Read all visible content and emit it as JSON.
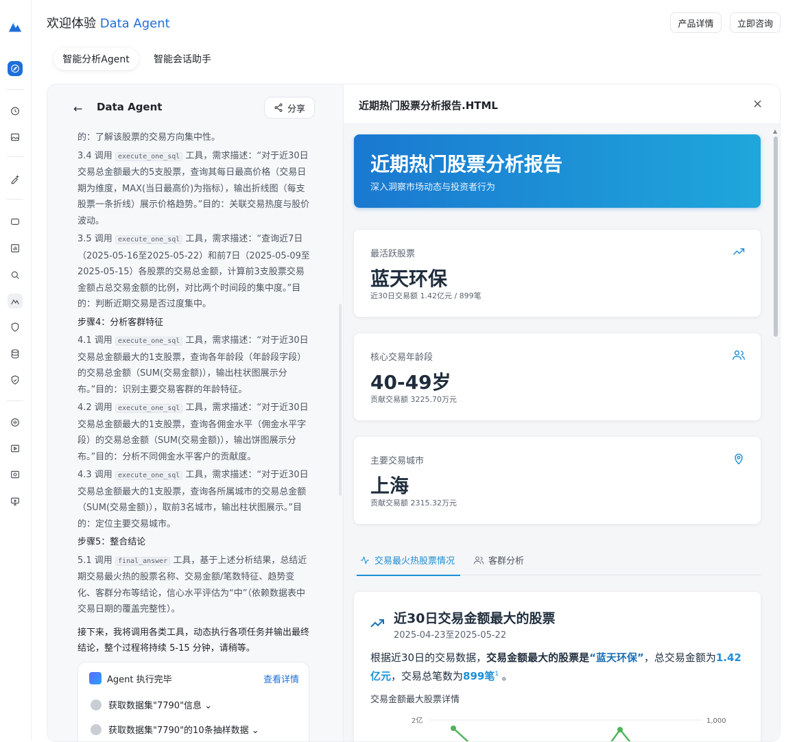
{
  "app": {
    "title_prefix": "欢迎体验",
    "title_highlight": "Data Agent",
    "btn_product": "产品详情",
    "btn_consult": "立即咨询"
  },
  "tabs": [
    "智能分析Agent",
    "智能会话助手"
  ],
  "left": {
    "agent_name": "Data Agent",
    "share": "分享",
    "agent_done": "Agent 执行完毕",
    "view_detail": "查看详情",
    "task1": "获取数据集\"7790\"信息",
    "task2": "获取数据集\"7790\"的10条抽样数据"
  },
  "right": {
    "file_title": "近期热门股票分析报告.HTML",
    "banner_title": "近期热门股票分析报告",
    "banner_sub": "深入洞察市场动态与投资者行为",
    "kpis": [
      {
        "label": "最活跃股票",
        "value": "蓝天环保",
        "sub": "近30日交易额 1.42亿元 / 899笔",
        "icon": "trend-up-icon"
      },
      {
        "label": "核心交易年龄段",
        "value": "40-49岁",
        "sub": "贡献交易额 3225.70万元",
        "icon": "users-icon"
      },
      {
        "label": "主要交易城市",
        "value": "上海",
        "sub": "贡献交易额 2315.32万元",
        "icon": "location-pin-icon"
      }
    ],
    "tab_hot": "交易最火热股票情况",
    "tab_cust": "客群分析",
    "card_title": "近30日交易金额最大的股票",
    "card_date": "2025-04-23至2025-05-22",
    "card_text_1": "根据近30日的交易数据，",
    "card_text_2": "交易金额最大的股票是",
    "card_text_3": "“蓝天环保”",
    "card_text_4": "，总交易金额为",
    "card_text_5": "1.42亿元",
    "card_text_6": "，交易总笔数为",
    "card_text_7": "899笔",
    "card_sup": "1",
    "card_text_8": " 。",
    "detail_label": "交易金额最大股票详情",
    "chart_y_left": "2亿",
    "chart_y_right": "1,000"
  },
  "chart_data": {
    "type": "line",
    "title": "交易金额最大股票详情",
    "yticks_left": [
      "2亿"
    ],
    "yticks_right": [
      "1,000"
    ]
  }
}
